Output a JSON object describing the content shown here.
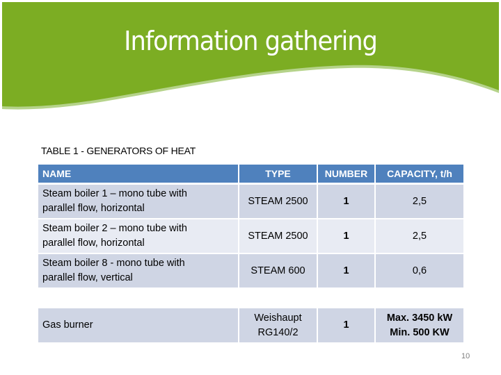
{
  "slide": {
    "title": "Information gathering",
    "page_number": "10",
    "colors": {
      "banner_green": "#7cad23",
      "banner_edge": "#b5d38a",
      "header_blue": "#4f81bd",
      "row_dark": "#cfd5e4",
      "row_light": "#e8ebf3"
    }
  },
  "table": {
    "caption": "TABLE 1 - GENERATORS OF HEAT",
    "headers": {
      "name": "NAME",
      "type": "TYPE",
      "number": "NUMBER",
      "capacity": "CAPACITY, t/h"
    },
    "rows": [
      {
        "name_line1": "Steam boiler 1 – mono tube with",
        "name_line2": "parallel flow, horizontal",
        "type_line1": "STEAM 2500",
        "type_line2": "",
        "number": "1",
        "capacity_line1": "2,5",
        "capacity_line2": ""
      },
      {
        "name_line1": "Steam boiler 2 – mono tube with",
        "name_line2": "parallel flow, horizontal",
        "type_line1": "STEAM 2500",
        "type_line2": "",
        "number": "1",
        "capacity_line1": "2,5",
        "capacity_line2": ""
      },
      {
        "name_line1": "Steam boiler 8 -  mono tube with",
        "name_line2": "parallel flow, vertical",
        "type_line1": "STEAM 600",
        "type_line2": "",
        "number": "1",
        "capacity_line1": "0,6",
        "capacity_line2": ""
      },
      {
        "name_line1": "Gas burner",
        "name_line2": "",
        "type_line1": "Weishaupt",
        "type_line2": "RG140/2",
        "number": "1",
        "capacity_line1": "Max. 3450 kW",
        "capacity_line2": "Min. 500 KW"
      }
    ]
  }
}
